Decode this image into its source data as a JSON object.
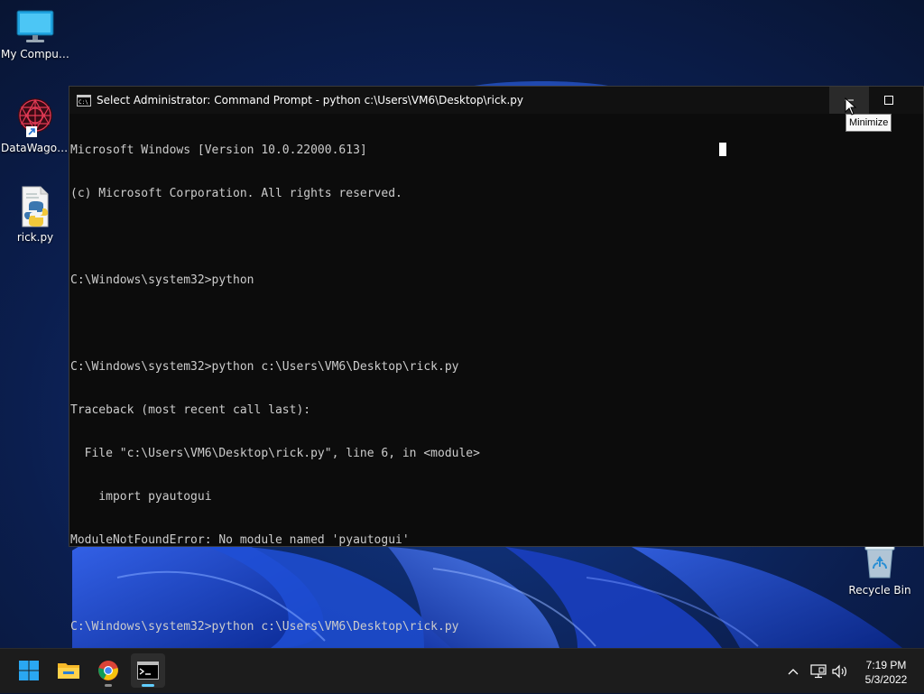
{
  "desktop": {
    "icons": [
      {
        "label": "My Computer",
        "icon": "monitor-icon"
      },
      {
        "label": "DataWagon...",
        "icon": "datawagon-icon"
      },
      {
        "label": "rick.py",
        "icon": "python-file-icon"
      },
      {
        "label": "Recycle Bin",
        "icon": "recycle-bin-icon"
      }
    ]
  },
  "cmd_window": {
    "title": "Select Administrator: Command Prompt - python  c:\\Users\\VM6\\Desktop\\rick.py",
    "minimize_tooltip": "Minimize",
    "lines": [
      "Microsoft Windows [Version 10.0.22000.613]",
      "(c) Microsoft Corporation. All rights reserved.",
      "",
      "C:\\Windows\\system32>python",
      "",
      "C:\\Windows\\system32>python c:\\Users\\VM6\\Desktop\\rick.py",
      "Traceback (most recent call last):",
      "  File \"c:\\Users\\VM6\\Desktop\\rick.py\", line 6, in <module>",
      "    import pyautogui",
      "ModuleNotFoundError: No module named 'pyautogui'",
      "",
      "C:\\Windows\\system32>python c:\\Users\\VM6\\Desktop\\rick.py"
    ]
  },
  "taskbar": {
    "apps": [
      {
        "name": "start",
        "icon": "windows-logo-icon"
      },
      {
        "name": "file-explorer",
        "icon": "folder-icon"
      },
      {
        "name": "chrome",
        "icon": "chrome-icon"
      },
      {
        "name": "command-prompt",
        "icon": "terminal-icon",
        "active": true
      }
    ],
    "tray": {
      "icons": [
        "chevron-up-icon",
        "network-icon",
        "volume-icon"
      ],
      "time": "7:19 PM",
      "date": "5/3/2022"
    }
  },
  "colors": {
    "console_bg": "#0c0c0c",
    "console_text": "#cccccc",
    "taskbar_bg": "#1c1c1c",
    "active_indicator": "#60cdff"
  }
}
